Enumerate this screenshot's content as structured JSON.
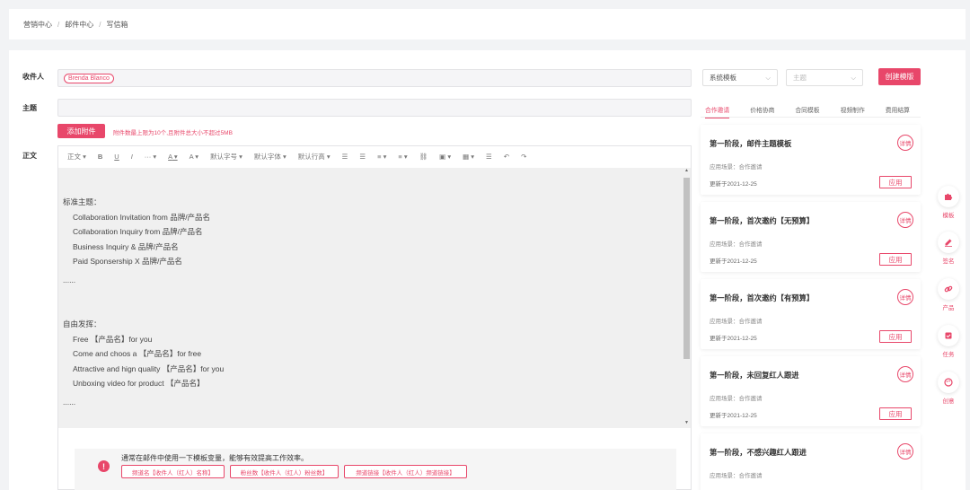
{
  "breadcrumb": {
    "items": [
      "营销中心",
      "邮件中心",
      "写信箱"
    ],
    "sep": "/"
  },
  "form": {
    "recipient_label": "收件人",
    "recipient_chip": "Brenda Blanco",
    "subject_label": "主题",
    "body_label": "正文",
    "attach_button": "添加附件",
    "attach_note": "附件数最上限为10个,且附件总大小不超过5MB"
  },
  "toolbar": [
    "正文",
    "B",
    "U",
    "I",
    "···",
    "A",
    "A",
    "默认字号",
    "默认字体",
    "默认行高",
    "☰",
    "☰",
    "≡",
    "≡",
    "⛓",
    "▣",
    "▦",
    "☰",
    "↶",
    "↷"
  ],
  "editor": {
    "h1": "标准主题：",
    "std": [
      "Collaboration Invitation from 品牌/产品名",
      "Collaboration Inquiry from 品牌/产品名",
      "Business Inquiry & 品牌/产品名",
      "Paid Sponsership X 品牌/产品名"
    ],
    "dots1": "......",
    "h2": "自由发挥：",
    "free": [
      "Free 【产品名】for you",
      "Come and choos a 【产品名】for free",
      "Attractive and hign quality 【产品名】for you",
      "Unboxing video for product 【产品名】"
    ],
    "dots2": "......"
  },
  "tip": {
    "text": "通常在邮件中使用一下模板变量，能够有效提高工作效率。",
    "vars": [
      "频道名【收件人（红人）名称】",
      "粉丝数【收件人（红人）粉丝数】",
      "频道链接【收件人（红人）频道链接】"
    ]
  },
  "templates": {
    "select1": "系统模板",
    "select2": "主题",
    "create_button": "创建模版",
    "tabs": [
      "合作邀请",
      "价格协商",
      "合同模板",
      "视频制作",
      "费用结算"
    ],
    "active_tab": 0,
    "cards": [
      {
        "title": "第一阶段，邮件主题模板",
        "scene": "应用场景：合作邀请",
        "date": "更新于2021-12-25",
        "apply": "应用",
        "badge": "详情"
      },
      {
        "title": "第一阶段，首次邀约【无预算】",
        "scene": "应用场景：合作邀请",
        "date": "更新于2021-12-25",
        "apply": "应用",
        "badge": "详情"
      },
      {
        "title": "第一阶段，首次邀约【有预算】",
        "scene": "应用场景：合作邀请",
        "date": "更新于2021-12-25",
        "apply": "应用",
        "badge": "详情"
      },
      {
        "title": "第一阶段，未回复红人跟进",
        "scene": "应用场景：合作邀请",
        "date": "更新于2021-12-25",
        "apply": "应用",
        "badge": "详情"
      },
      {
        "title": "第一阶段，不感兴趣红人跟进",
        "scene": "应用场景：合作邀请",
        "date": "",
        "apply": "",
        "badge": "详情"
      }
    ]
  },
  "side": [
    {
      "label": "模板",
      "icon": "puzzle-icon"
    },
    {
      "label": "签名",
      "icon": "pen-icon"
    },
    {
      "label": "产品",
      "icon": "link-icon"
    },
    {
      "label": "任务",
      "icon": "task-icon"
    },
    {
      "label": "创意",
      "icon": "palette-icon"
    }
  ],
  "colors": {
    "accent": "#e8476a"
  }
}
